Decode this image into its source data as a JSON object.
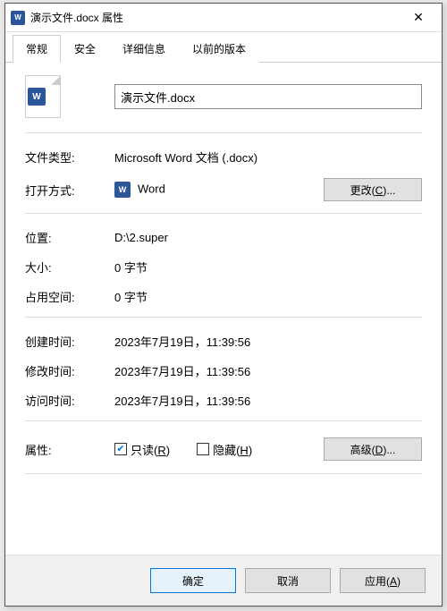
{
  "window": {
    "title": "演示文件.docx 属性"
  },
  "tabs": {
    "general": "常规",
    "security": "安全",
    "details": "详细信息",
    "previous": "以前的版本"
  },
  "file": {
    "name": "演示文件.docx"
  },
  "labels": {
    "filetype": "文件类型:",
    "openwith": "打开方式:",
    "location": "位置:",
    "size": "大小:",
    "sizeondisk": "占用空间:",
    "created": "创建时间:",
    "modified": "修改时间:",
    "accessed": "访问时间:",
    "attributes": "属性:"
  },
  "values": {
    "filetype": "Microsoft Word 文档 (.docx)",
    "openwith_app": "Word",
    "location": "D:\\2.super",
    "size": "0 字节",
    "sizeondisk": "0 字节",
    "created": "2023年7月19日，11:39:56",
    "modified": "2023年7月19日，11:39:56",
    "accessed": "2023年7月19日，11:39:56"
  },
  "buttons": {
    "change": "更改(C)...",
    "advanced": "高级(D)...",
    "ok": "确定",
    "cancel": "取消",
    "apply": "应用(A)"
  },
  "checkboxes": {
    "readonly": "只读(R)",
    "hidden": "隐藏(H)"
  },
  "state": {
    "readonly_checked": true,
    "hidden_checked": false
  }
}
